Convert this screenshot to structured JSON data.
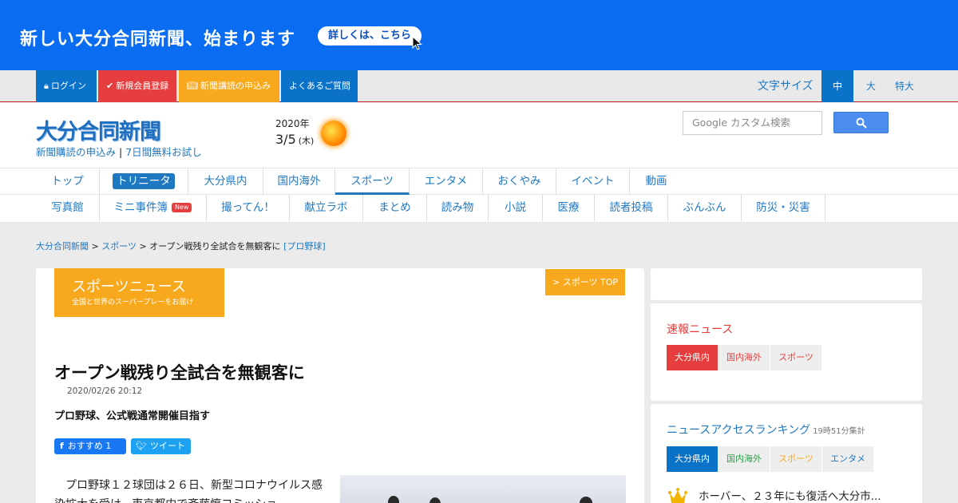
{
  "banner": {
    "text": "新しい大分合同新聞、始まります",
    "button": "詳しくは、こちら"
  },
  "topbar": {
    "items": [
      {
        "icon": "lock-icon",
        "label": "ログイン",
        "color": "#0a72c9"
      },
      {
        "icon": "check-circle-icon",
        "label": "新規会員登録",
        "color": "#e63e3e"
      },
      {
        "icon": "book-icon",
        "label": "新聞講読の申込み",
        "color": "#f8a81c"
      },
      {
        "icon": "",
        "label": "よくあるご質問",
        "color": "#0a72c9"
      }
    ],
    "fontsize": {
      "label": "文字サイズ",
      "options": [
        "中",
        "大",
        "特大"
      ],
      "selected": "中"
    }
  },
  "header": {
    "logo": "大分合同新聞",
    "sublinks": [
      "新聞購読の申込み",
      "7日間無料お試し"
    ],
    "sublink_sep": "|",
    "date": {
      "year": "2020年",
      "day": "3/5",
      "weekday": "(木)"
    },
    "weather_icon": "sunny-icon",
    "search": {
      "placeholder": "Google カスタム検索"
    }
  },
  "nav_primary": [
    "トップ",
    "トリニータ",
    "大分県内",
    "国内海外",
    "スポーツ",
    "エンタメ",
    "おくやみ",
    "イベント",
    "動画"
  ],
  "nav_secondary": [
    "写真館",
    "ミニ事件簿",
    "撮ってん！",
    "献立ラボ",
    "まとめ",
    "読み物",
    "小説",
    "医療",
    "読者投稿",
    "ぶんぶん",
    "防災・災害"
  ],
  "new_badge": "New",
  "breadcrumb": {
    "home": "大分合同新聞",
    "sep": ">",
    "section": "スポーツ",
    "current": "オープン戦残り全試合を無観客に",
    "tag": "[プロ野球]"
  },
  "section": {
    "title": "スポーツニュース",
    "subtitle": "全国と世界のスーパープレーをお届け",
    "top_link": "> スポーツ TOP"
  },
  "article": {
    "title": "オープン戦残り全試合を無観客に",
    "date": "2020/02/26 20:12",
    "subtitle": "プロ野球、公式戦通常開催目指す",
    "share": {
      "facebook": "おすすめ 1",
      "twitter": "ツイート"
    },
    "body": "プロ野球１２球団は２６日、新型コロナウイルス感染拡大を受け、東京都内で斉藤惇コミッショ"
  },
  "sidebar": {
    "breaking": {
      "title": "速報ニュース",
      "tabs": [
        "大分県内",
        "国内海外",
        "スポーツ"
      ]
    },
    "ranking": {
      "title": "ニュースアクセスランキング",
      "note": "19時51分集計",
      "tabs": [
        "大分県内",
        "国内海外",
        "スポーツ",
        "エンタメ"
      ],
      "first_item": "ホーバー、２３年にも復活へ大分市..."
    }
  },
  "colors": {
    "banner": "#0a6cf0",
    "accent_blue": "#0a72c9",
    "accent_orange": "#f8a81c",
    "accent_red": "#e63e3e",
    "link": "#1f78c2"
  }
}
